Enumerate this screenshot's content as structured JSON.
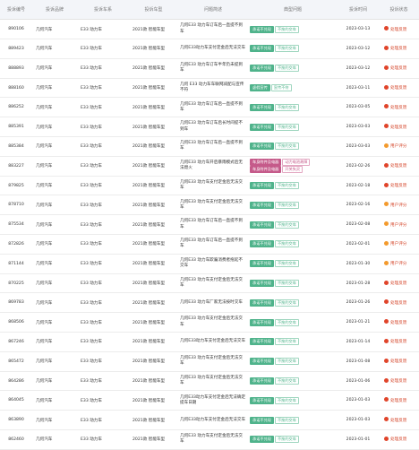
{
  "headers": [
    "投诉编号",
    "投诉品牌",
    "投诉车系",
    "投诉车型",
    "问题简述",
    "典型问题",
    "投诉时间",
    "投诉状态"
  ],
  "colors": {
    "red": "#e0442a",
    "orange": "#f39a2d"
  },
  "rows": [
    {
      "id": "890106",
      "brand": "几何汽车",
      "series": "E33 动力车",
      "model": "2021款 智能车型",
      "desc": "几何E33 动力车订车后一直提不到车",
      "tags": [
        {
          "t": "承诺不兑现",
          "k": "green"
        },
        {
          "t": "不按约交车",
          "k": "green-o"
        }
      ],
      "time": "2023-03-13",
      "status": "处理反馈",
      "dot": "red",
      "icon": "●"
    },
    {
      "id": "889423",
      "brand": "几何汽车",
      "series": "E33 动力车",
      "model": "2021款 智能车型",
      "desc": "几何E33动力车支付定金后无法交车",
      "tags": [
        {
          "t": "承诺不兑现",
          "k": "green"
        },
        {
          "t": "不按约交车",
          "k": "green-o"
        }
      ],
      "time": "2023-03-12",
      "status": "处理反馈",
      "dot": "red",
      "icon": "●"
    },
    {
      "id": "888893",
      "brand": "几何汽车",
      "series": "E33 动力车",
      "model": "2021款 智能车型",
      "desc": "几何E33 动力车订车半年仍未提到车",
      "tags": [
        {
          "t": "承诺不兑现",
          "k": "green"
        },
        {
          "t": "不按约交车",
          "k": "green-o"
        }
      ],
      "time": "2023-03-12",
      "status": "处理反馈",
      "dot": "red",
      "icon": "●"
    },
    {
      "id": "888160",
      "brand": "几何汽车",
      "series": "E33 动力车",
      "model": "2021款 智能车型",
      "desc": "几何 E33 动力车车联网减配与宣传不符",
      "tags": [
        {
          "t": "虚假宣传",
          "k": "green"
        },
        {
          "t": "宣传不符",
          "k": "green-o"
        }
      ],
      "time": "2023-03-11",
      "status": "处理反馈",
      "dot": "red",
      "icon": "●"
    },
    {
      "id": "886252",
      "brand": "几何汽车",
      "series": "E33 动力车",
      "model": "2021款 智能车型",
      "desc": "几何E33 动力车订车后一直提不到车",
      "tags": [
        {
          "t": "承诺不兑现",
          "k": "green"
        },
        {
          "t": "不按约交车",
          "k": "green-o"
        }
      ],
      "time": "2023-03-05",
      "status": "处理反馈",
      "dot": "red",
      "icon": "●"
    },
    {
      "id": "885391",
      "brand": "几何汽车",
      "series": "E33 动力车",
      "model": "2021款 智能车型",
      "desc": "几何E33 动力车订车后长时间提不到车",
      "tags": [
        {
          "t": "承诺不兑现",
          "k": "green"
        },
        {
          "t": "不按约交车",
          "k": "green-o"
        }
      ],
      "time": "2023-03-03",
      "status": "处理反馈",
      "dot": "red",
      "icon": "●"
    },
    {
      "id": "885384",
      "brand": "几何汽车",
      "series": "E33 动力车",
      "model": "2021款 智能车型",
      "desc": "几何E33 动力车订车后一直提不到车",
      "tags": [
        {
          "t": "承诺不兑现",
          "k": "green"
        },
        {
          "t": "不按约交车",
          "k": "green-o"
        }
      ],
      "time": "2023-03-03",
      "status": "用户评分",
      "dot": "orange",
      "icon": "●"
    },
    {
      "id": "883227",
      "brand": "几何汽车",
      "series": "E33 动力车",
      "model": "2021款 智能车型",
      "desc": "几何E33 动力车开启暴雨模式后无法熄火",
      "tags": [
        {
          "t": "车身附件及电器",
          "k": "pink"
        },
        {
          "t": "动力电池故障",
          "k": "pink-o"
        },
        {
          "t": "车身附件及电器",
          "k": "pink"
        },
        {
          "t": "开关失灵",
          "k": "pink-o"
        }
      ],
      "time": "2023-02-26",
      "status": "处理反馈",
      "dot": "red",
      "icon": "●"
    },
    {
      "id": "879825",
      "brand": "几何汽车",
      "series": "E33 动力车",
      "model": "2021款 智能车型",
      "desc": "几何E33 动力车支付定金后无法交车",
      "tags": [
        {
          "t": "承诺不兑现",
          "k": "green"
        },
        {
          "t": "不按约交车",
          "k": "green-o"
        }
      ],
      "time": "2023-02-18",
      "status": "处理反馈",
      "dot": "red",
      "icon": "●"
    },
    {
      "id": "878710",
      "brand": "几何汽车",
      "series": "E33 动力车",
      "model": "2021款 智能车型",
      "desc": "几何E33 动力车支付定金后无法交车",
      "tags": [
        {
          "t": "承诺不兑现",
          "k": "green"
        },
        {
          "t": "不按约交车",
          "k": "green-o"
        }
      ],
      "time": "2023-02-16",
      "status": "用户评分",
      "dot": "orange",
      "icon": "●"
    },
    {
      "id": "875534",
      "brand": "几何汽车",
      "series": "E33 动力车",
      "model": "2021款 智能车型",
      "desc": "几何E33 动力车订车后一直提不到车",
      "tags": [
        {
          "t": "承诺不兑现",
          "k": "green"
        },
        {
          "t": "不按约交车",
          "k": "green-o"
        }
      ],
      "time": "2023-02-08",
      "status": "用户评分",
      "dot": "orange",
      "icon": "●"
    },
    {
      "id": "872826",
      "brand": "几何汽车",
      "series": "E33 动力车",
      "model": "2021款 智能车型",
      "desc": "几何E33 动力车订车后一直提不到车",
      "tags": [
        {
          "t": "承诺不兑现",
          "k": "green"
        },
        {
          "t": "不按约交车",
          "k": "green-o"
        }
      ],
      "time": "2023-02-01",
      "status": "用户评分",
      "dot": "orange",
      "icon": "●"
    },
    {
      "id": "871144",
      "brand": "几何汽车",
      "series": "E33 动力车",
      "model": "2021款 智能车型",
      "desc": "几何E33 动力车欺骗消费者拖延不交车",
      "tags": [
        {
          "t": "承诺不兑现",
          "k": "green"
        },
        {
          "t": "不按约交车",
          "k": "green-o"
        }
      ],
      "time": "2023-01-30",
      "status": "用户评分",
      "dot": "orange",
      "icon": "●"
    },
    {
      "id": "870225",
      "brand": "几何汽车",
      "series": "E33 动力车",
      "model": "2021款 智能车型",
      "desc": "几何E33 动力车支付定金后无法交车",
      "tags": [
        {
          "t": "承诺不兑现",
          "k": "green"
        },
        {
          "t": "不按约交车",
          "k": "green-o"
        }
      ],
      "time": "2023-01-28",
      "status": "处理反馈",
      "dot": "red",
      "icon": "●"
    },
    {
      "id": "869783",
      "brand": "几何汽车",
      "series": "E33 动力车",
      "model": "2021款 智能车型",
      "desc": "几何E33 动力车厂家无法按时交车",
      "tags": [
        {
          "t": "承诺不兑现",
          "k": "green"
        },
        {
          "t": "不按约交车",
          "k": "green-o"
        }
      ],
      "time": "2023-01-26",
      "status": "处理反馈",
      "dot": "red",
      "icon": "●"
    },
    {
      "id": "868506",
      "brand": "几何汽车",
      "series": "E33 动力车",
      "model": "2021款 智能车型",
      "desc": "几何E33 动力车支付定金后无法交车",
      "tags": [
        {
          "t": "承诺不兑现",
          "k": "green"
        },
        {
          "t": "不按约交车",
          "k": "green-o"
        }
      ],
      "time": "2023-01-21",
      "status": "处理反馈",
      "dot": "red",
      "icon": "●"
    },
    {
      "id": "867246",
      "brand": "几何汽车",
      "series": "E33 动力车",
      "model": "2021款 智能车型",
      "desc": "几何E33动力车支付定金后无法交车",
      "tags": [
        {
          "t": "承诺不兑现",
          "k": "green"
        },
        {
          "t": "不按约交车",
          "k": "green-o"
        }
      ],
      "time": "2023-01-14",
      "status": "处理反馈",
      "dot": "red",
      "icon": "●"
    },
    {
      "id": "865472",
      "brand": "几何汽车",
      "series": "E33 动力车",
      "model": "2021款 智能车型",
      "desc": "几何E33 动力车支付定金后无法交车",
      "tags": [
        {
          "t": "承诺不兑现",
          "k": "green"
        },
        {
          "t": "不按约交车",
          "k": "green-o"
        }
      ],
      "time": "2023-01-08",
      "status": "处理反馈",
      "dot": "red",
      "icon": "●"
    },
    {
      "id": "864286",
      "brand": "几何汽车",
      "series": "E33 动力车",
      "model": "2021款 智能车型",
      "desc": "几何E33 动力车支付定金后无法交车",
      "tags": [
        {
          "t": "承诺不兑现",
          "k": "green"
        },
        {
          "t": "不按约交车",
          "k": "green-o"
        }
      ],
      "time": "2023-01-06",
      "status": "处理反馈",
      "dot": "red",
      "icon": "●"
    },
    {
      "id": "864045",
      "brand": "几何汽车",
      "series": "E33 动力车",
      "model": "2021款 智能车型",
      "desc": "几何E33动力车支付定金后无法确定提车日期",
      "tags": [
        {
          "t": "承诺不兑现",
          "k": "green"
        },
        {
          "t": "不按约交车",
          "k": "green-o"
        }
      ],
      "time": "2023-01-03",
      "status": "处理反馈",
      "dot": "red",
      "icon": "●"
    },
    {
      "id": "863890",
      "brand": "几何汽车",
      "series": "E33 动力车",
      "model": "2021款 智能车型",
      "desc": "几何E33动力车支付定金后无法交车",
      "tags": [
        {
          "t": "承诺不兑现",
          "k": "green"
        },
        {
          "t": "不按约交车",
          "k": "green-o"
        }
      ],
      "time": "2023-01-03",
      "status": "处理反馈",
      "dot": "red",
      "icon": "●"
    },
    {
      "id": "862460",
      "brand": "几何汽车",
      "series": "E33 动力车",
      "model": "2021款 智能车型",
      "desc": "几何E33 动力车支付定金后无法交车",
      "tags": [
        {
          "t": "承诺不兑现",
          "k": "green"
        },
        {
          "t": "不按约交车",
          "k": "green-o"
        }
      ],
      "time": "2023-01-01",
      "status": "处理反馈",
      "dot": "red",
      "icon": "●"
    }
  ]
}
